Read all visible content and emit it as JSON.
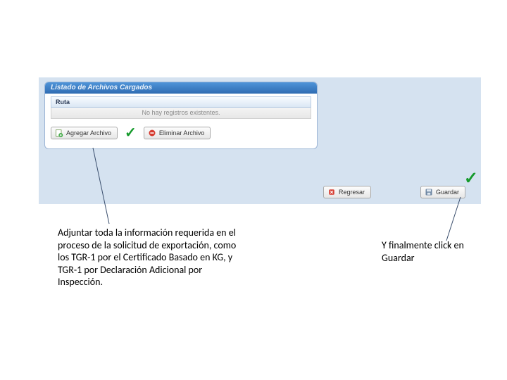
{
  "panel": {
    "title": "Listado de Archivos Cargados",
    "column": "Ruta",
    "empty_msg": "No hay registros existentes."
  },
  "buttons": {
    "add": "Agregar Archivo",
    "delete": "Eliminar Archivo",
    "back": "Regresar",
    "save": "Guardar"
  },
  "annotations": {
    "left": "Adjuntar toda la información requerida en el proceso de la solicitud de exportación, como los TGR-1 por el Certificado Basado en KG, y TGR-1 por Declaración Adicional por Inspección.",
    "right": "Y finalmente click en Guardar"
  }
}
